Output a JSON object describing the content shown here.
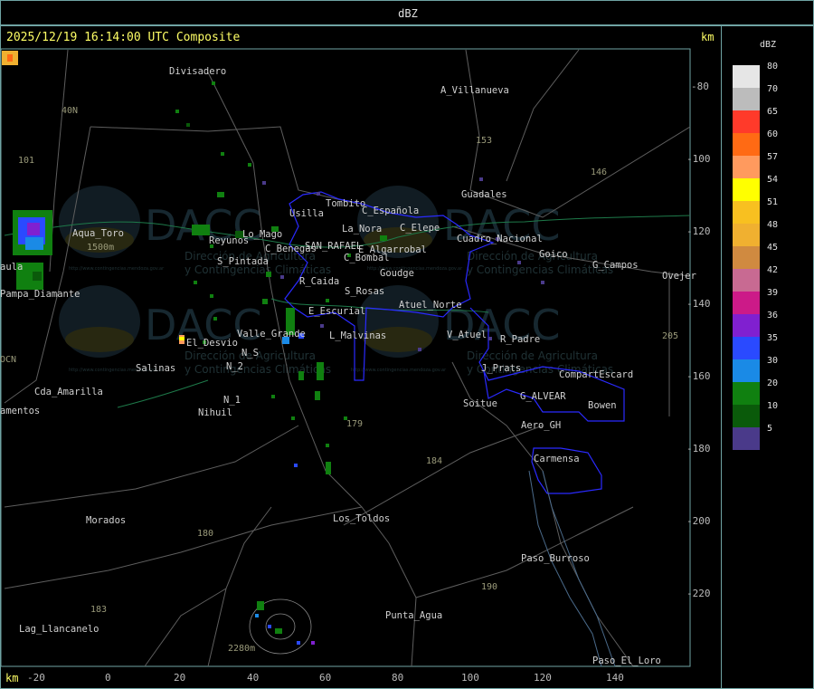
{
  "header": {
    "title": "dBZ"
  },
  "map": {
    "timestamp": "2025/12/19 16:14:00 UTC Composite",
    "unit_top": "km",
    "unit_bottom": "km",
    "x_ticks": [
      "-20",
      "0",
      "20",
      "40",
      "60",
      "80",
      "100",
      "120",
      "140"
    ],
    "y_ticks": [
      "-80",
      "-100",
      "-120",
      "-140",
      "-160",
      "-180",
      "-200",
      "-220"
    ],
    "places": [
      "Divisadero",
      "A_Villanueva",
      "40N",
      "101",
      "153",
      "146",
      "Guadales",
      "Tombito",
      "Usilla",
      "C_Española",
      "La_Nora",
      "C_Elepe",
      "Cuadro_Nacional",
      "Aqua_Toro",
      "1500m",
      "Reyunos",
      "Lo_Mago",
      "C_Benegas",
      "SAN_RAFAEL",
      "E_Algarrobal",
      "Goico",
      "G_Campos",
      "Ovejer",
      "C_Bombal",
      "S_Pintada",
      "R_Caida",
      "Goudge",
      "Pampa_Diamante",
      "S_Rosas",
      "Atuel_Norte",
      "E_Escurial",
      "Valle_Grande",
      "L_Malvinas",
      "V_Atuel",
      "R_Padre",
      "El_Desvio",
      "205",
      "Salinas",
      "N_S",
      "N_2",
      "J_Prats",
      "CompartEscard",
      "Cda_Amarilla",
      "N_1",
      "G_ALVEAR",
      "amentos",
      "Nihuil",
      "Soitue",
      "Bowen",
      "Aero_GH",
      "179",
      "Carmensa",
      "184",
      "Morados",
      "Los_Toldos",
      "180",
      "Paso_Burroso",
      "190",
      "183",
      "Lag_Llancanelo",
      "Punta_Agua",
      "2280m",
      "Paso_El_Loro",
      "aula",
      "OCN"
    ],
    "watermark": {
      "brand": "DACC",
      "line1": "Dirección de Agricultura",
      "line2": "y Contingencias Climáticas",
      "url": "http://www.contingencias.mendoza.gov.ar"
    },
    "colors": {
      "frame": "#6fa3a3",
      "timestamp": "#ffff66",
      "boundary_blue": "#2a2aff",
      "roads": "#6a6a6a",
      "river": "#1e7a4a"
    }
  },
  "legend": {
    "unit": "dBZ",
    "items": [
      {
        "label": "80",
        "color": "#e6e6e6"
      },
      {
        "label": "70",
        "color": "#bcbcbc"
      },
      {
        "label": "65",
        "color": "#ff3a2a"
      },
      {
        "label": "60",
        "color": "#ff6a14"
      },
      {
        "label": "57",
        "color": "#ff9a5e"
      },
      {
        "label": "54",
        "color": "#ffff00"
      },
      {
        "label": "51",
        "color": "#f8c020"
      },
      {
        "label": "48",
        "color": "#f0b030"
      },
      {
        "label": "45",
        "color": "#d08a40"
      },
      {
        "label": "42",
        "color": "#c86a92"
      },
      {
        "label": "39",
        "color": "#cc1a88"
      },
      {
        "label": "36",
        "color": "#8020d0"
      },
      {
        "label": "35",
        "color": "#2a4aff"
      },
      {
        "label": "30",
        "color": "#1a8ae6"
      },
      {
        "label": "20",
        "color": "#108010"
      },
      {
        "label": "10",
        "color": "#0a5a0a"
      },
      {
        "label": "5",
        "color": "#4a3a8a"
      }
    ]
  }
}
